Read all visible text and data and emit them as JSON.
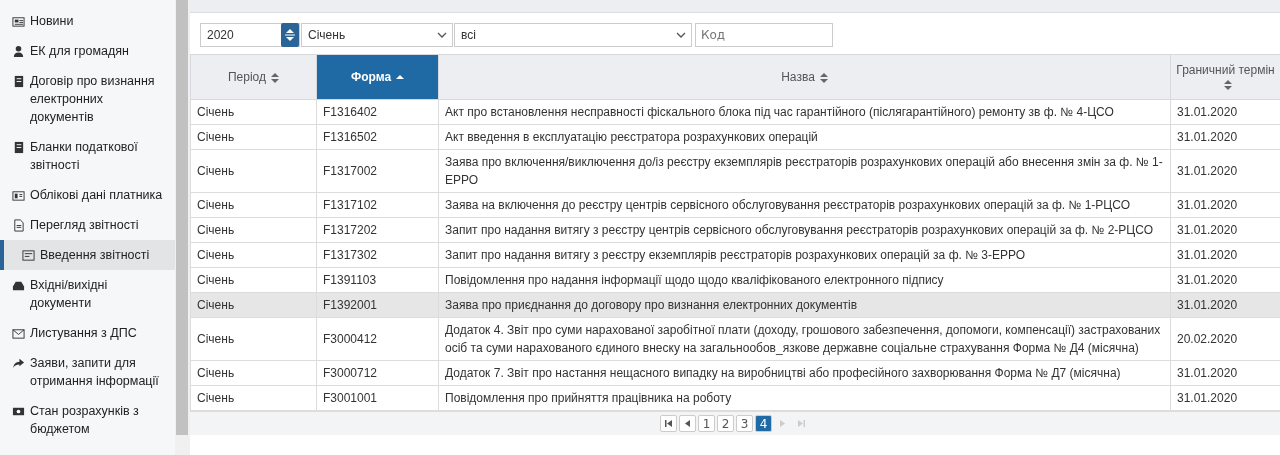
{
  "sidebar": {
    "items": [
      {
        "label": "Новини",
        "selected": false
      },
      {
        "label": "ЕК для громадян",
        "selected": false
      },
      {
        "label": "Договір про визнання електронних документів",
        "selected": false
      },
      {
        "label": "Бланки податкової звітності",
        "selected": false
      },
      {
        "label": "Облікові дані платника",
        "selected": false
      },
      {
        "label": "Перегляд звітності",
        "selected": false
      },
      {
        "label": "Введення звітності",
        "selected": true
      },
      {
        "label": "Вхідні/вихідні документи",
        "selected": false
      },
      {
        "label": "Листування з ДПС",
        "selected": false
      },
      {
        "label": "Заяви, запити для отримання інформації",
        "selected": false
      },
      {
        "label": "Стан розрахунків з бюджетом",
        "selected": false
      }
    ]
  },
  "filters": {
    "year": "2020",
    "month": "Січень",
    "type": "всі",
    "code_placeholder": "Код"
  },
  "table": {
    "columns": [
      {
        "label": "Період",
        "sorted": false
      },
      {
        "label": "Форма",
        "sorted": true
      },
      {
        "label": "Назва",
        "sorted": false
      },
      {
        "label": "Граничний термін",
        "sorted": false
      }
    ],
    "rows": [
      {
        "period": "Січень",
        "form": "F1316402",
        "name": "Акт про встановлення несправності фіскального блока під час гарантійного (післягарантійного) ремонту зв ф. № 4-ЦСО",
        "deadline": "31.01.2020",
        "selected": false
      },
      {
        "period": "Січень",
        "form": "F1316502",
        "name": "Акт введення в експлуатацію реєстратора розрахункових операцій",
        "deadline": "31.01.2020",
        "selected": false
      },
      {
        "period": "Січень",
        "form": "F1317002",
        "name": "Заява про включення/виключення до/із реєстру екземплярів реєстраторів розрахункових операцій або внесення змін за ф. № 1-ЕРРО",
        "deadline": "31.01.2020",
        "selected": false
      },
      {
        "period": "Січень",
        "form": "F1317102",
        "name": "Заява на включення до реєстру центрів сервісного обслуговування реєстраторів розрахункових операцій за ф. № 1-РЦСО",
        "deadline": "31.01.2020",
        "selected": false
      },
      {
        "period": "Січень",
        "form": "F1317202",
        "name": "Запит про надання витягу з реєстру центрів сервісного обслуговування реєстраторів розрахункових операцій за ф. № 2-РЦСО",
        "deadline": "31.01.2020",
        "selected": false
      },
      {
        "period": "Січень",
        "form": "F1317302",
        "name": "Запит про надання витягу з реєстру екземплярів реєстраторів розрахункових операцій за ф. № 3-ЕРРО",
        "deadline": "31.01.2020",
        "selected": false
      },
      {
        "period": "Січень",
        "form": "F1391103",
        "name": "Повідомлення про надання інформації щодо щодо кваліфікованого електронного підпису",
        "deadline": "31.01.2020",
        "selected": false
      },
      {
        "period": "Січень",
        "form": "F1392001",
        "name": "Заява про приєднання до договору про визнання електронних документів",
        "deadline": "31.01.2020",
        "selected": true
      },
      {
        "period": "Січень",
        "form": "F3000412",
        "name": "Додаток 4. Звіт про суми нарахованої заробітної плати (доходу, грошового забезпечення, допомоги, компенсації) застрахованих осіб та суми нарахованого єдиного внеску на загальнообов_язкове державне соціальне страхування Форма № Д4 (місячна)",
        "deadline": "20.02.2020",
        "selected": false
      },
      {
        "period": "Січень",
        "form": "F3000712",
        "name": "Додаток 7. Звіт про настання нещасного випадку на виробництві або професійного захворювання Форма № Д7 (місячна)",
        "deadline": "31.01.2020",
        "selected": false
      },
      {
        "period": "Січень",
        "form": "F3001001",
        "name": "Повідомлення про прийняття працівника на роботу",
        "deadline": "31.01.2020",
        "selected": false
      }
    ]
  },
  "pagination": {
    "pages": [
      {
        "label": "1",
        "selected": false
      },
      {
        "label": "2",
        "selected": false
      },
      {
        "label": "3",
        "selected": false
      },
      {
        "label": "4",
        "selected": true
      }
    ],
    "next_disabled": true
  }
}
